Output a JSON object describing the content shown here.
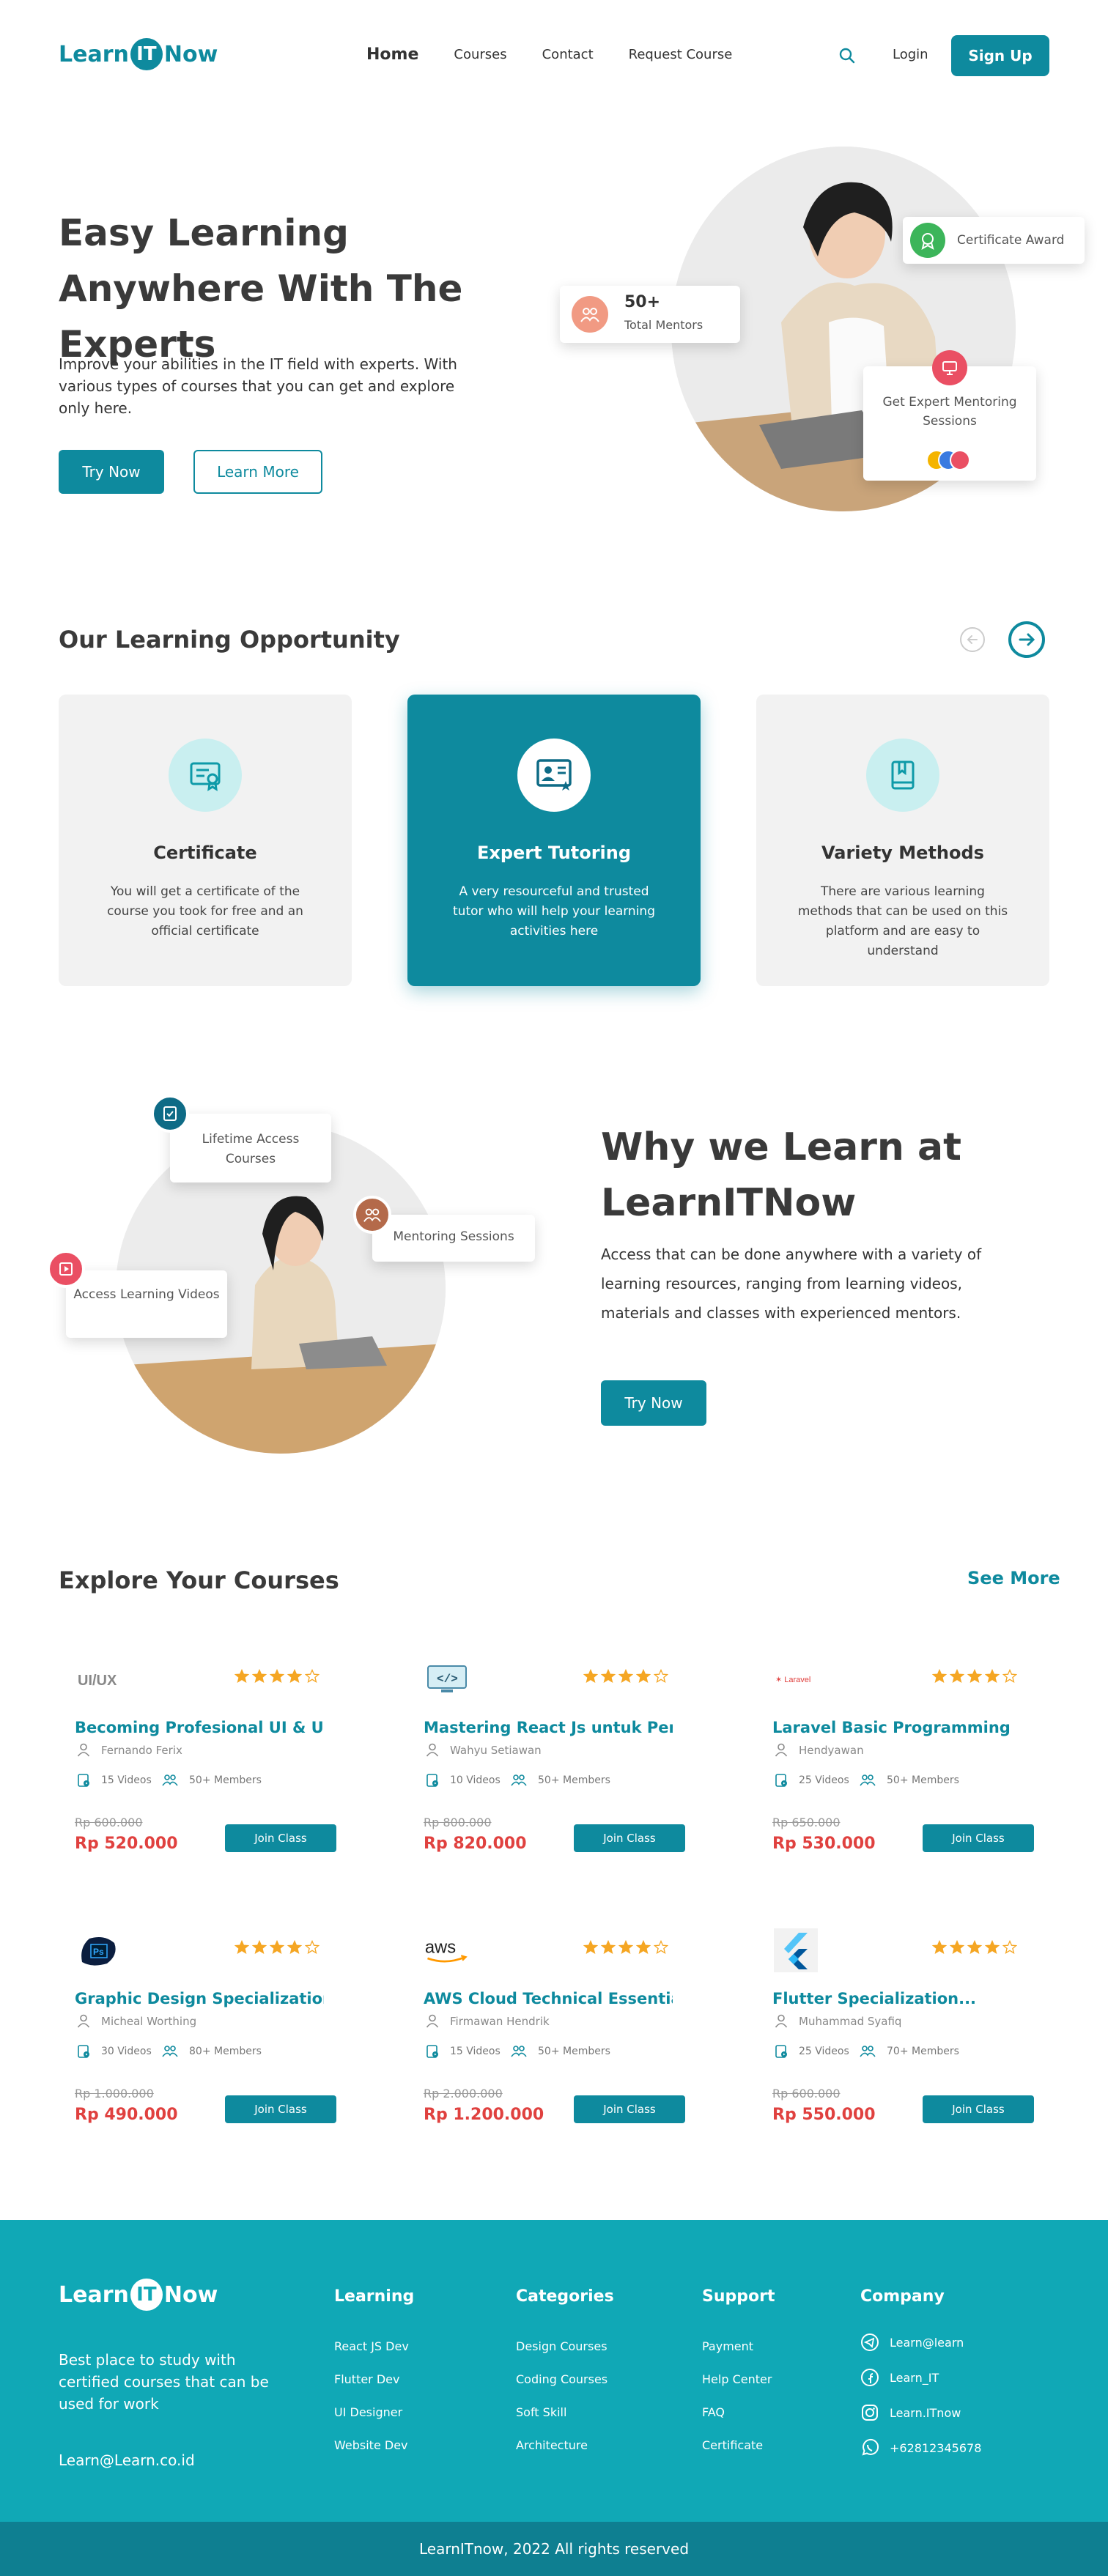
{
  "header": {
    "logo_pre": "Learn",
    "logo_mid": "IT",
    "logo_post": "Now",
    "nav": [
      "Home",
      "Courses",
      "Contact",
      "Request Course"
    ],
    "login": "Login",
    "signup": "Sign Up"
  },
  "hero": {
    "title": "Easy Learning Anywhere With The Experts",
    "description": "Improve your abilities in the IT field with experts. With various types of courses that you can get and explore only here.",
    "try_now": "Try Now",
    "learn_more": "Learn More",
    "mentors_count": "50+",
    "mentors_label": "Total Mentors",
    "certificate_award": "Certificate Award",
    "expert_mentoring": "Get Expert Mentoring Sessions"
  },
  "opportunity": {
    "title": "Our Learning Opportunity",
    "cards": [
      {
        "title": "Certificate",
        "desc": "You will get a certificate of the course you took for free and an official certificate"
      },
      {
        "title": "Expert Tutoring",
        "desc": "A very resourceful and trusted tutor who will help your learning activities here"
      },
      {
        "title": "Variety Methods",
        "desc": "There are various learning methods that can be used on this platform and are easy to understand"
      }
    ]
  },
  "why": {
    "title": "Why we Learn at LearnITNow",
    "description": "Access that can be done anywhere with a variety of learning resources, ranging from learning videos, materials and classes with experienced mentors.",
    "try_now": "Try Now",
    "lifetime": "Lifetime Access Courses",
    "mentoring": "Mentoring Sessions",
    "videos": "Access Learning Videos"
  },
  "courses": {
    "title": "Explore Your Courses",
    "see_more": "See More",
    "join_label": "Join Class",
    "rating_stars": 4,
    "items": [
      {
        "logo": "UI/UX",
        "title": "Becoming Profesional UI & UX...",
        "author": "Fernando Ferix",
        "videos": "15 Videos",
        "members": "50+ Members",
        "old_price": "Rp 600.000",
        "price": "Rp 520.000"
      },
      {
        "logo": "</>",
        "title": "Mastering React Js untuk Pemula",
        "author": "Wahyu Setiawan",
        "videos": "10 Videos",
        "members": "50+ Members",
        "old_price": "Rp 800.000",
        "price": "Rp 820.000"
      },
      {
        "logo": "Laravel",
        "title": "Laravel Basic Programming",
        "author": "Hendyawan",
        "videos": "25 Videos",
        "members": "50+ Members",
        "old_price": "Rp 650.000",
        "price": "Rp 530.000"
      },
      {
        "logo": "Ps",
        "title": "Graphic Design Specialization",
        "author": "Micheal Worthing",
        "videos": "30 Videos",
        "members": "80+ Members",
        "old_price": "Rp 1.000.000",
        "price": "Rp 490.000"
      },
      {
        "logo": "aws",
        "title": "AWS Cloud Technical Essentials",
        "author": "Firmawan Hendrik",
        "videos": "15 Videos",
        "members": "50+ Members",
        "old_price": "Rp 2.000.000",
        "price": "Rp 1.200.000"
      },
      {
        "logo": "flutter",
        "title": "Flutter Specialization...",
        "author": "Muhammad Syafiq",
        "videos": "25 Videos",
        "members": "70+ Members",
        "old_price": "Rp 600.000",
        "price": "Rp 550.000"
      }
    ]
  },
  "footer": {
    "tagline": "Best place to study with certified courses that can be used for work",
    "email": "Learn@Learn.co.id",
    "columns": [
      {
        "title": "Learning",
        "links": [
          "React JS Dev",
          "Flutter Dev",
          "UI Designer",
          "Website Dev"
        ]
      },
      {
        "title": "Categories",
        "links": [
          "Design Courses",
          "Coding Courses",
          "Soft Skill",
          "Architecture"
        ]
      },
      {
        "title": "Support",
        "links": [
          "Payment",
          "Help Center",
          "FAQ",
          "Certificate"
        ]
      }
    ],
    "company_title": "Company",
    "social": [
      "Learn@learn",
      "Learn_IT",
      "Learn.ITnow",
      "+62812345678"
    ],
    "copyright": "LearnITnow, 2022 All rights reserved"
  },
  "colors": {
    "primary": "#0e8a9e",
    "footer": "#10a8b6",
    "price": "#e0413f",
    "star": "#f5a623"
  }
}
